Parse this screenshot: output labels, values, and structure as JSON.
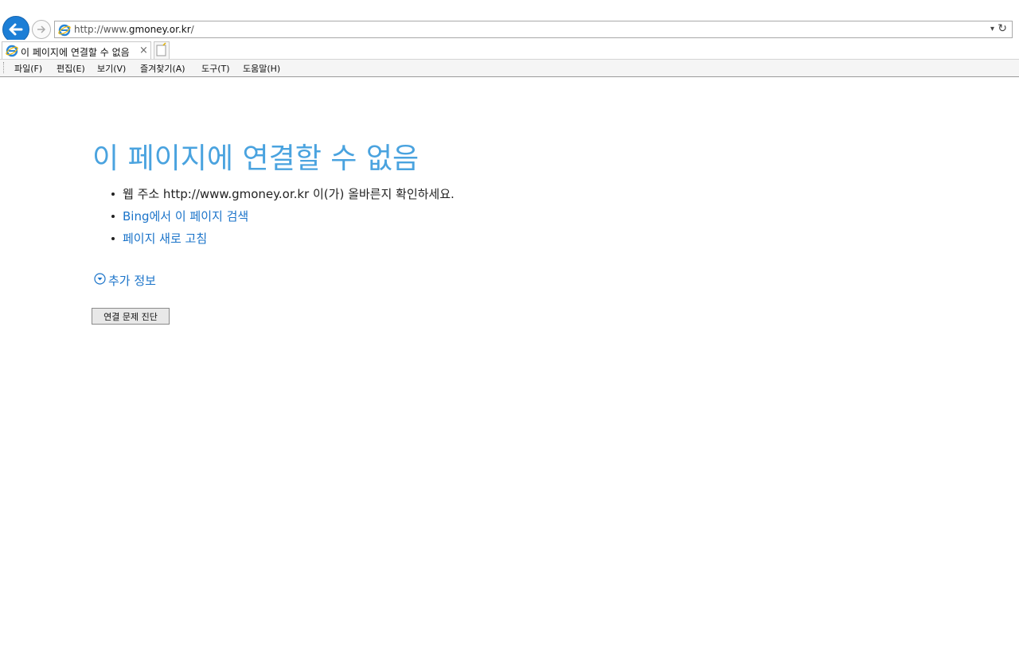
{
  "browser": {
    "address_prefix": "http://www.",
    "address_domain": "gmoney.or.kr",
    "address_suffix": "/",
    "tab_title": "이 페이지에 연결할 수 없음",
    "tab_close": "×",
    "menu": [
      "파일(F)",
      "편집(E)",
      "보기(V)",
      "즐겨찾기(A)",
      "도구(T)",
      "도움말(H)"
    ]
  },
  "page": {
    "heading": "이 페이지에 연결할 수 없음",
    "bullet_1": "웹 주소 http://www.gmoney.or.kr 이(가) 올바른지 확인하세요.",
    "bullet_2": "Bing에서 이 페이지 검색",
    "bullet_3": "페이지 새로 고침",
    "more_info": "추가 정보",
    "diagnose_button": "연결 문제 진단"
  },
  "colors": {
    "heading": "#4aa3df",
    "link": "#1a73c9",
    "back_button": "#1c7ed6"
  },
  "icons": [
    "back-arrow-icon",
    "forward-arrow-icon",
    "ie-logo-icon",
    "dropdown-icon",
    "refresh-icon",
    "new-tab-icon",
    "expand-chevron-icon"
  ]
}
